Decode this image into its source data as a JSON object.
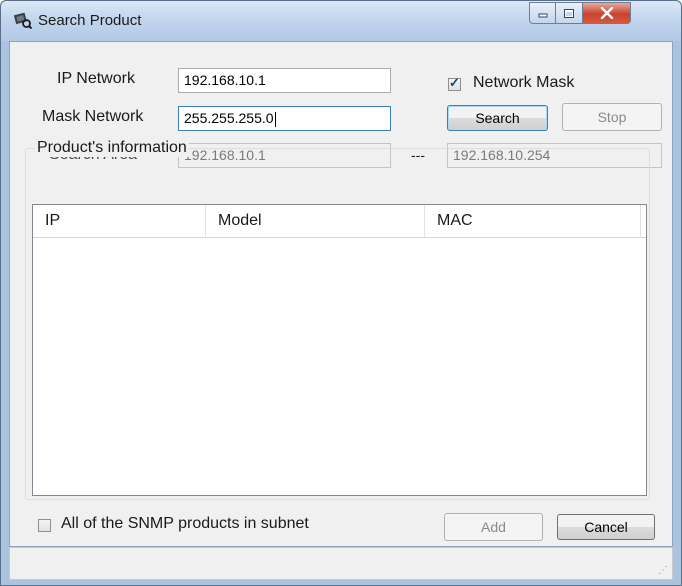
{
  "window": {
    "title": "Search Product",
    "icon": "product-search-icon"
  },
  "form": {
    "ip_network_label": "IP Network",
    "ip_network_value": "192.168.10.1",
    "mask_network_label": "Mask Network",
    "mask_network_value": "255.255.255.0",
    "search_area_label": "Search Area",
    "search_area_start": "192.168.10.1",
    "search_area_separator": "---",
    "search_area_end": "192.168.10.254",
    "network_mask_label": "Network Mask",
    "network_mask_checked": true
  },
  "buttons": {
    "search": "Search",
    "stop": "Stop",
    "add": "Add",
    "cancel": "Cancel"
  },
  "products": {
    "group_title": "Product's information",
    "columns": [
      "IP",
      "Model",
      "MAC"
    ],
    "rows": []
  },
  "footer": {
    "snmp_label": "All of the SNMP products in subnet",
    "snmp_checked": false
  },
  "colors": {
    "title_bar": "#c0d4ec",
    "close_button": "#c7452e",
    "dialog_background": "#f0f0f0"
  }
}
